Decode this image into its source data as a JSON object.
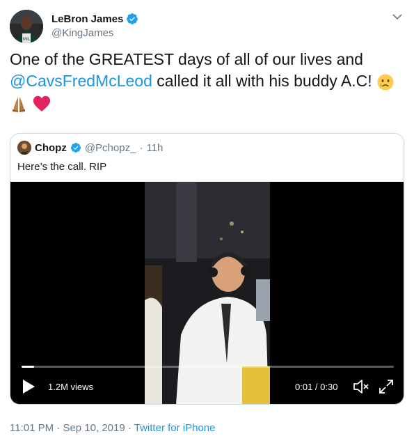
{
  "author": {
    "display_name": "LeBron James",
    "handle": "@KingJames",
    "avatar_icon": "profile-photo-icon",
    "verified": true
  },
  "tweet": {
    "text_before": "One of the GREATEST days of all of our lives and",
    "mention": "@CavsFredMcLeod",
    "text_after": "called it all with his buddy A.C!",
    "emojis": [
      "crying-face-icon",
      "folded-hands-icon",
      "red-heart-icon"
    ]
  },
  "quoted_tweet": {
    "display_name": "Chopz",
    "handle": "@Pchopz_",
    "separator": "·",
    "time": "11h",
    "text": "Here’s the call. RIP",
    "verified": true
  },
  "video": {
    "views": "1.2M views",
    "time": "0:01 / 0:30",
    "progress": 0.033
  },
  "meta": {
    "time": "11:01 PM",
    "separator1": "·",
    "date": "Sep 10, 2019",
    "separator2": "·",
    "source": "Twitter for iPhone"
  },
  "colors": {
    "accent": "#1b95e0",
    "verified": "#1da1f2",
    "secondary_text": "#657786",
    "heart": "#e0245e"
  }
}
